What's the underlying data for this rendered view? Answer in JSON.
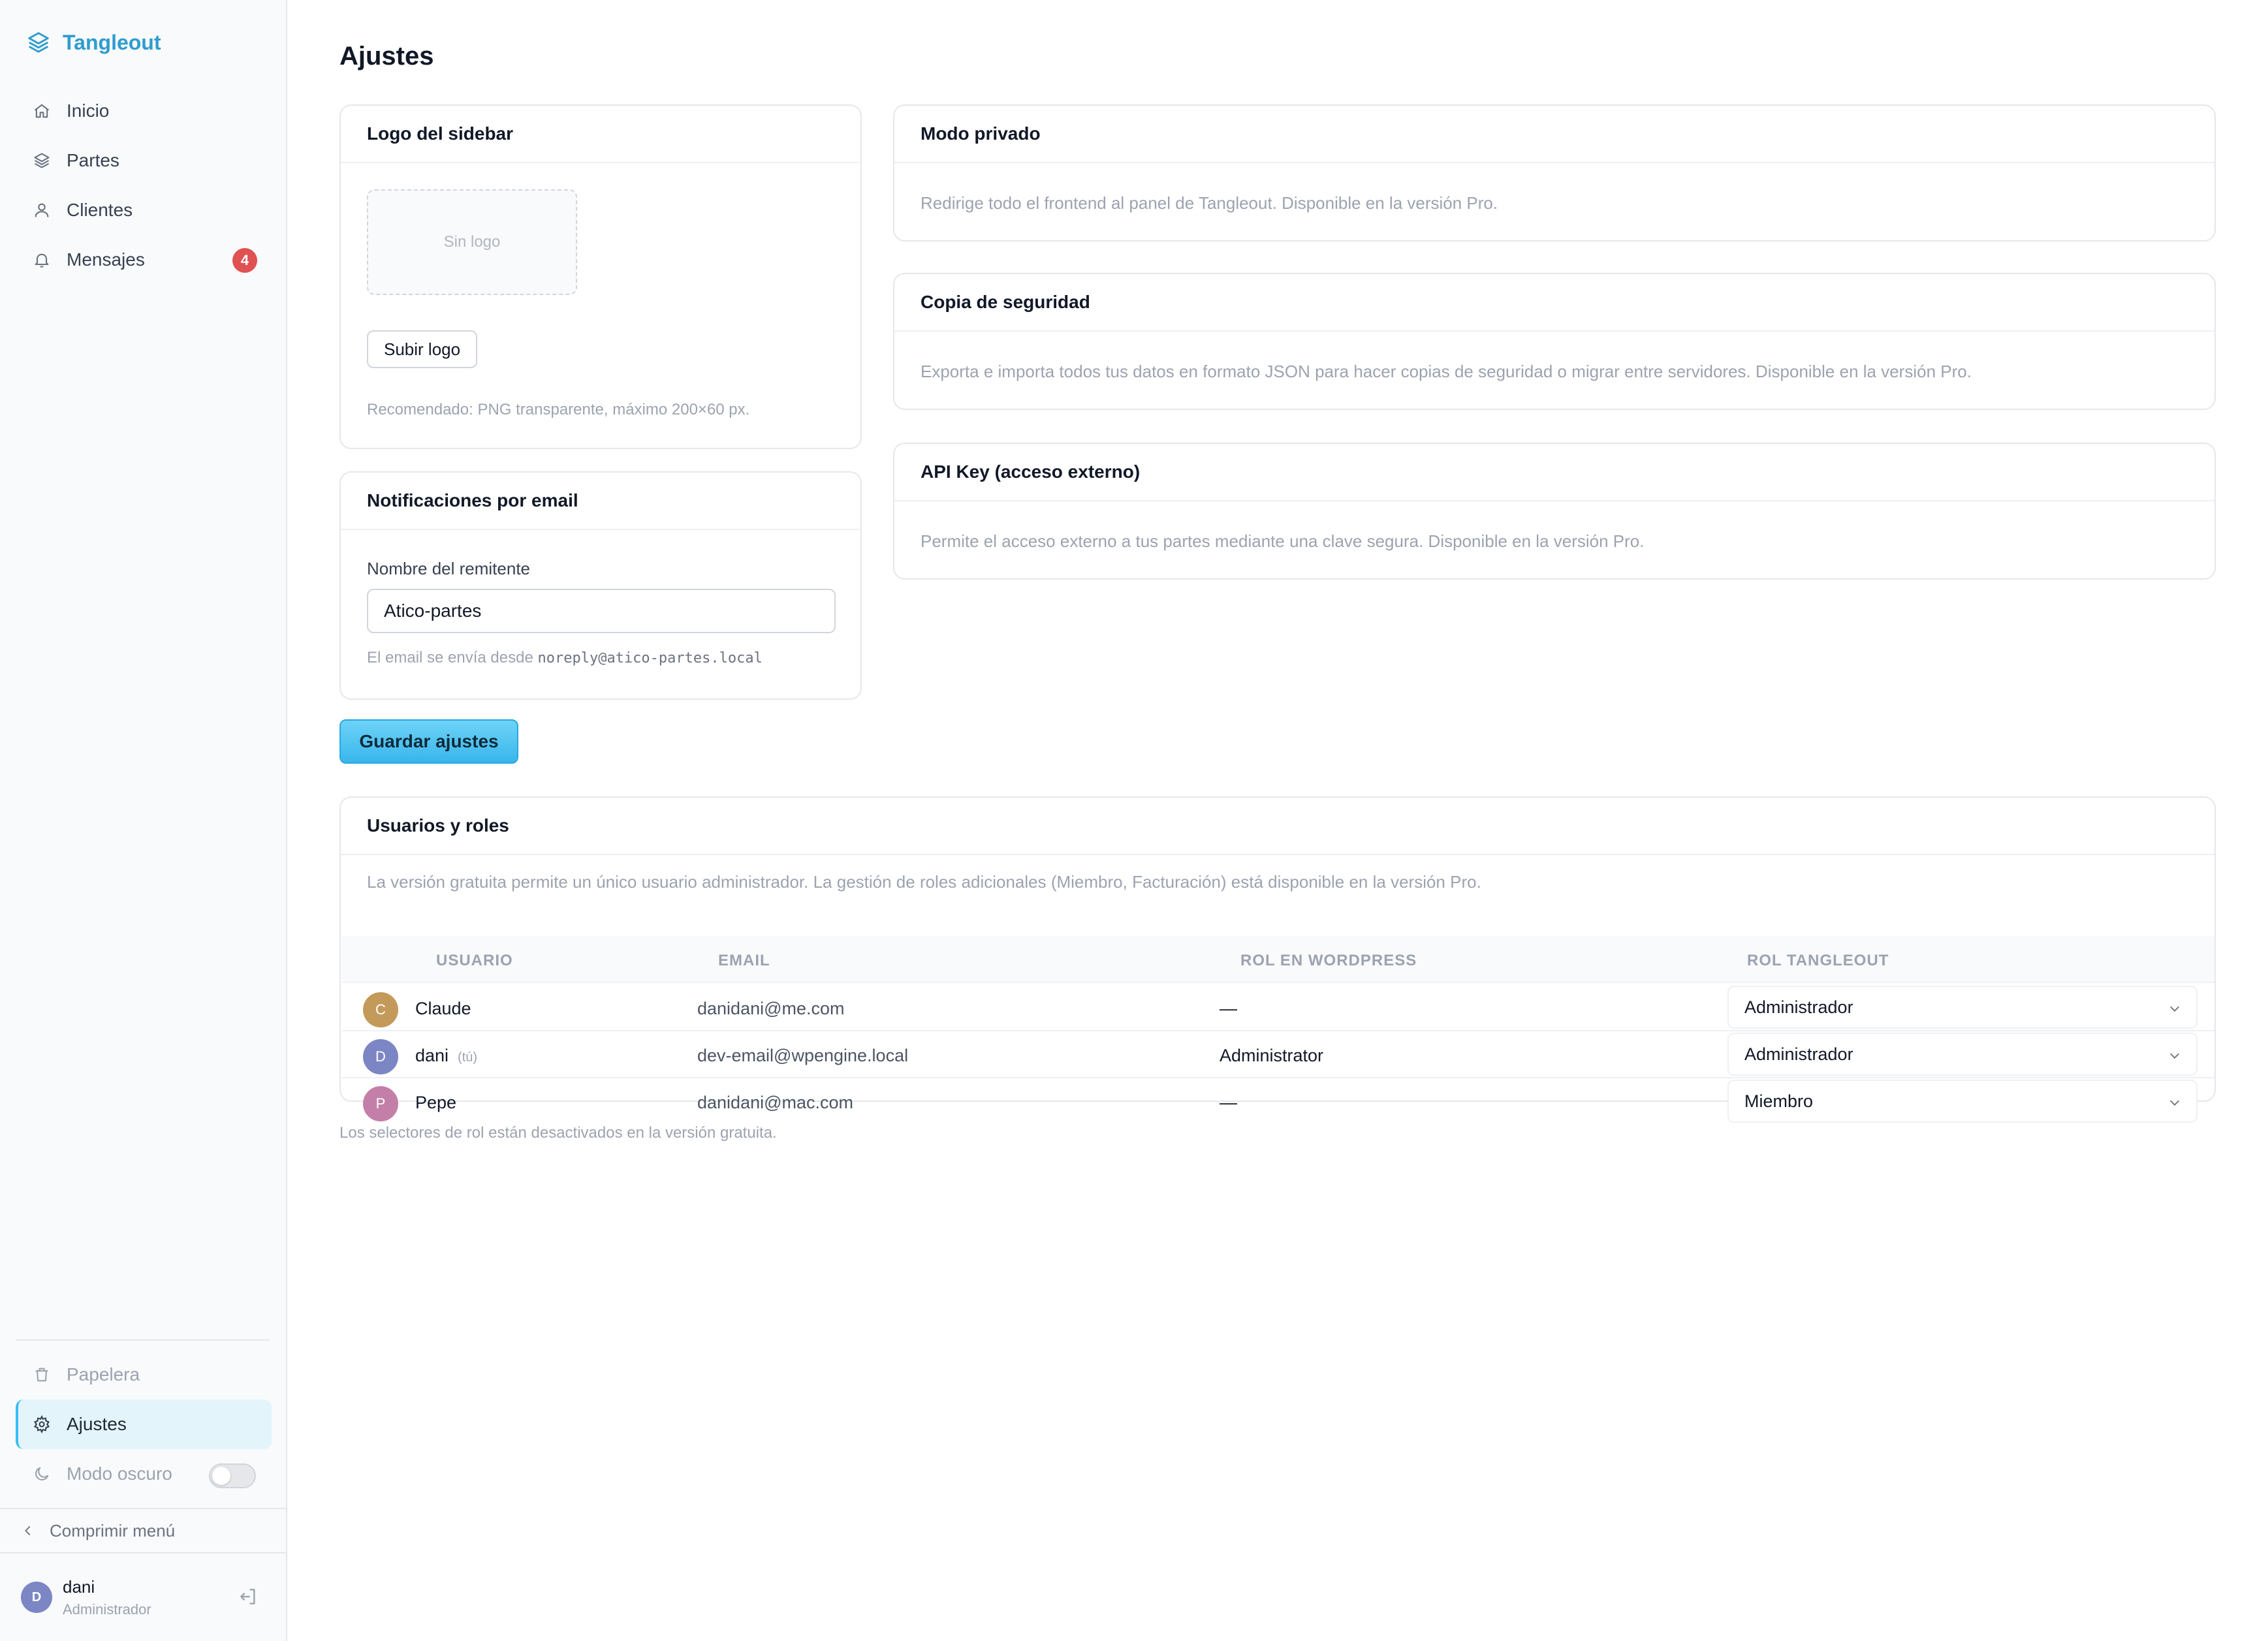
{
  "app": {
    "name": "Tangleout",
    "brand_color": "#2f9ccf",
    "accent_color": "#38bdf8"
  },
  "sidebar": {
    "items": [
      {
        "label": "Inicio",
        "icon": "home-icon"
      },
      {
        "label": "Partes",
        "icon": "layers-icon"
      },
      {
        "label": "Clientes",
        "icon": "user-icon"
      },
      {
        "label": "Mensajes",
        "icon": "bell-icon",
        "badge": "4"
      }
    ],
    "bottom": {
      "trash": "Papelera",
      "settings": "Ajustes",
      "dark_mode": "Modo oscuro",
      "dark_mode_on": false
    },
    "collapse": "Comprimir menú",
    "user": {
      "initial": "D",
      "name": "dani",
      "role": "Administrador"
    }
  },
  "page": {
    "title": "Ajustes"
  },
  "logo_card": {
    "title": "Logo del sidebar",
    "placeholder": "Sin logo",
    "upload_button": "Subir logo",
    "hint": "Recomendado: PNG transparente, máximo 200×60 px."
  },
  "email_card": {
    "title": "Notificaciones por email",
    "field_label": "Nombre del remitente",
    "field_value": "Atico-partes",
    "hint_prefix": "El email se envía desde",
    "hint_email": "noreply@atico-partes.local"
  },
  "save_button": "Guardar ajustes",
  "private_card": {
    "title": "Modo privado",
    "desc": "Redirige todo el frontend al panel de Tangleout. Disponible en la versión Pro."
  },
  "backup_card": {
    "title": "Copia de seguridad",
    "desc": "Exporta e importa todos tus datos en formato JSON para hacer copias de seguridad o migrar entre servidores. Disponible en la versión Pro."
  },
  "api_card": {
    "title": "API Key (acceso externo)",
    "desc": "Permite el acceso externo a tus partes mediante una clave segura. Disponible en la versión Pro."
  },
  "users_card": {
    "title": "Usuarios y roles",
    "desc": "La versión gratuita permite un único usuario administrador. La gestión de roles adicionales (Miembro, Facturación) está disponible en la versión Pro.",
    "columns": [
      "USUARIO",
      "EMAIL",
      "ROL EN WORDPRESS",
      "ROL TANGLEOUT"
    ],
    "rows": [
      {
        "initial": "C",
        "avatar_color": "#c49a5a",
        "name": "Claude",
        "you": "",
        "email": "danidani@me.com",
        "wp_role": "—",
        "role": "Administrador"
      },
      {
        "initial": "D",
        "avatar_color": "#7c86c4",
        "name": "dani",
        "you": "(tú)",
        "email": "dev-email@wpengine.local",
        "wp_role": "Administrator",
        "role": "Administrador"
      },
      {
        "initial": "P",
        "avatar_color": "#c47fa8",
        "name": "Pepe",
        "you": "",
        "email": "danidani@mac.com",
        "wp_role": "—",
        "role": "Miembro"
      }
    ],
    "footnote": "Los selectores de rol están desactivados en la versión gratuita."
  }
}
